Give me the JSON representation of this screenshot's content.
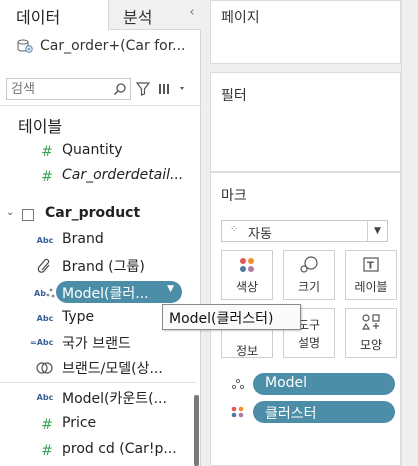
{
  "tabs": {
    "data": "데이터",
    "analysis": "분석"
  },
  "collapse_icon": "chevron-left-icon",
  "datasource": {
    "label": "Car_order+(Car for..."
  },
  "search": {
    "placeholder": "검색"
  },
  "tables_heading": "테이블",
  "fields_top": [
    {
      "icon": "#",
      "name": "Quantity",
      "italic": false
    },
    {
      "icon": "#",
      "name": "Car_orderdetail...",
      "italic": true
    }
  ],
  "table": {
    "name": "Car_product"
  },
  "fields": [
    {
      "icon": "Abc",
      "name": "Brand"
    },
    {
      "icon": "link",
      "name": "Brand (그룹)"
    },
    {
      "icon": "cluster",
      "name": "Model(클러..."
    },
    {
      "icon": "Abc",
      "name": "Type"
    },
    {
      "icon": "Abc",
      "name": "국가 브랜드"
    },
    {
      "icon": "set",
      "name": "브랜드/모델(상..."
    },
    {
      "icon": "Abc",
      "name": "Model(카운트(..."
    },
    {
      "icon": "#",
      "name": "Price"
    },
    {
      "icon": "#",
      "name": "prod cd (Car!p..."
    }
  ],
  "tooltip": "Model(클러스터)",
  "shelves": {
    "pages": "페이지",
    "filters": "필터",
    "marks": "마크"
  },
  "marks": {
    "type": "자동",
    "buttons": {
      "color": "색상",
      "size": "크기",
      "label": "레이블",
      "detail": "정보",
      "tooltip": "도구\n설명",
      "tooltip_line1": "도구",
      "tooltip_line2": "설명",
      "shape": "모양"
    },
    "pills": [
      {
        "icon": "detail-dots-icon",
        "label": "Model"
      },
      {
        "icon": "color-dots-icon",
        "label": "클러스터"
      }
    ]
  },
  "colors": {
    "pill": "#4c8ea8",
    "measure": "#3aa45b",
    "dimension": "#3a5f95"
  }
}
